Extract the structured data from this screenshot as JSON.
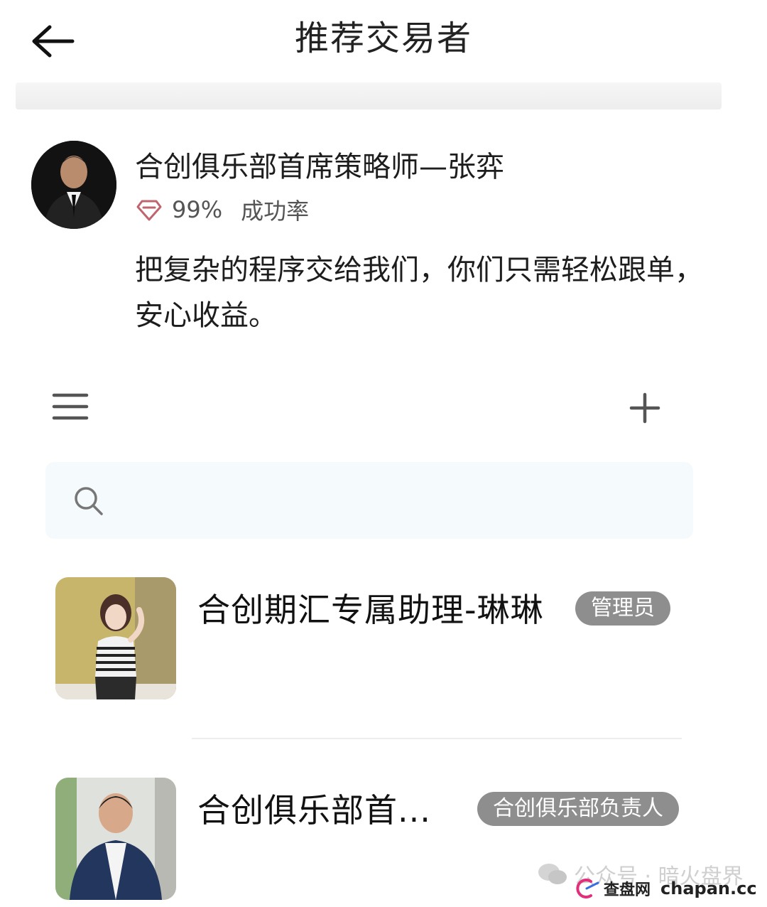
{
  "header": {
    "title": "推荐交易者",
    "back_icon": "arrow-left-icon"
  },
  "featured_trader": {
    "name": "合创俱乐部首席策略师—张弈",
    "success_rate": "99%",
    "success_rate_label": "成功率",
    "rate_icon": "diamond-icon",
    "description": "把复杂的程序交给我们，你们只需轻松跟单，安心收益。"
  },
  "toolbar": {
    "menu_icon": "hamburger-menu-icon",
    "add_icon": "plus-icon"
  },
  "search": {
    "icon": "search-icon",
    "value": ""
  },
  "members": [
    {
      "name": "合创期汇专属助理-琳琳",
      "badge": "管理员"
    },
    {
      "name": "合创俱乐部首...",
      "badge": "合创俱乐部负责人"
    }
  ],
  "watermark": {
    "account_line": "公众号 · 暗火盘界",
    "site_cn": "查盘网",
    "site_en": "chapan.cc"
  },
  "colors": {
    "badge_bg": "#8e8e8e",
    "search_bg": "#f5fafc",
    "text_primary": "#1d1d1d",
    "text_secondary": "#555555"
  }
}
